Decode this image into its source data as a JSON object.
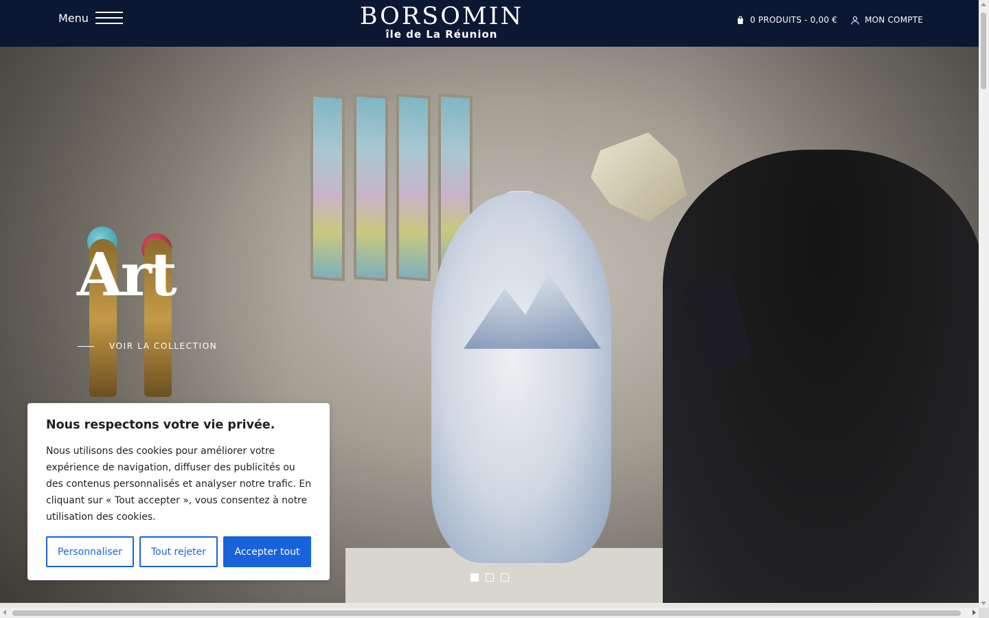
{
  "header": {
    "menu_label": "Menu",
    "logo_title": "BORSOMIN",
    "logo_subtitle": "île de La Réunion",
    "cart_label": "0 PRODUITS - 0,00 €",
    "account_label": "MON COMPTE"
  },
  "hero": {
    "title": "Art",
    "cta_label": "VOIR LA COLLECTION",
    "slides_count": 3,
    "active_slide": 1
  },
  "cookie": {
    "title": "Nous respectons votre vie privée.",
    "text": "Nous utilisons des cookies pour améliorer votre expérience de navigation, diffuser des publicités ou des contenus personnalisés et analyser notre trafic. En cliquant sur « Tout accepter », vous consentez à notre utilisation des cookies.",
    "customize_label": "Personnaliser",
    "reject_label": "Tout rejeter",
    "accept_label": "Accepter tout"
  },
  "colors": {
    "header_bg": "#0c1733",
    "accent": "#1863dc"
  }
}
